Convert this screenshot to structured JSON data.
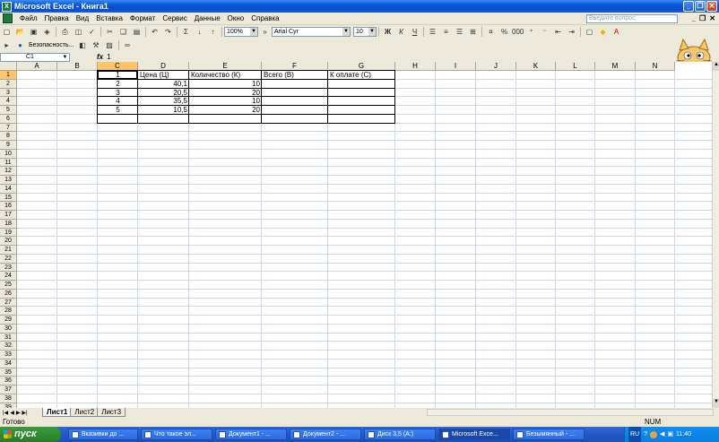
{
  "window": {
    "title": "Microsoft Excel - Книга1"
  },
  "menu": {
    "items": [
      "Файл",
      "Правка",
      "Вид",
      "Вставка",
      "Формат",
      "Сервис",
      "Данные",
      "Окно",
      "Справка"
    ],
    "help_placeholder": "Введите вопрос"
  },
  "toolbar": {
    "zoom": "100%",
    "font": "Arial Cyr",
    "font_size": "10",
    "security_label": "Безопасность..."
  },
  "formula_bar": {
    "cell_ref": "C1",
    "fx": "fx",
    "value": "1"
  },
  "columns": [
    "A",
    "B",
    "C",
    "D",
    "E",
    "F",
    "G",
    "H",
    "I",
    "J",
    "K",
    "L",
    "M",
    "N"
  ],
  "rows": [
    "1",
    "2",
    "3",
    "4",
    "5",
    "6",
    "7",
    "8",
    "9",
    "10",
    "11",
    "12",
    "13",
    "14",
    "15",
    "16",
    "17",
    "18",
    "19",
    "20",
    "21",
    "22",
    "23",
    "24",
    "25",
    "26",
    "27",
    "28",
    "29",
    "30",
    "31",
    "32",
    "33",
    "34",
    "35",
    "36",
    "37",
    "38",
    "39"
  ],
  "table": {
    "headers": {
      "c": "1",
      "d": "Цена (Ц)",
      "e": "Количество (К)",
      "f": "Всего (В)",
      "g": "К оплате (С)"
    },
    "rows": [
      {
        "c": "2",
        "d": "40,1",
        "e": "10"
      },
      {
        "c": "3",
        "d": "20,5",
        "e": "20"
      },
      {
        "c": "4",
        "d": "35,5",
        "e": "10"
      },
      {
        "c": "5",
        "d": "10,5",
        "e": "20"
      }
    ]
  },
  "sheets": [
    "Лист1",
    "Лист2",
    "Лист3"
  ],
  "status": {
    "text": "Готово",
    "num": "NUM"
  },
  "taskbar": {
    "start": "пуск",
    "tasks": [
      "Вказивки до ...",
      "Что такое эл...",
      "Документ1 - ...",
      "Документ2 - ...",
      "Диск 3,5 (A:)",
      "Microsoft Exce...",
      "Безымянный - ..."
    ],
    "lang": "RU",
    "time": "11:40"
  }
}
